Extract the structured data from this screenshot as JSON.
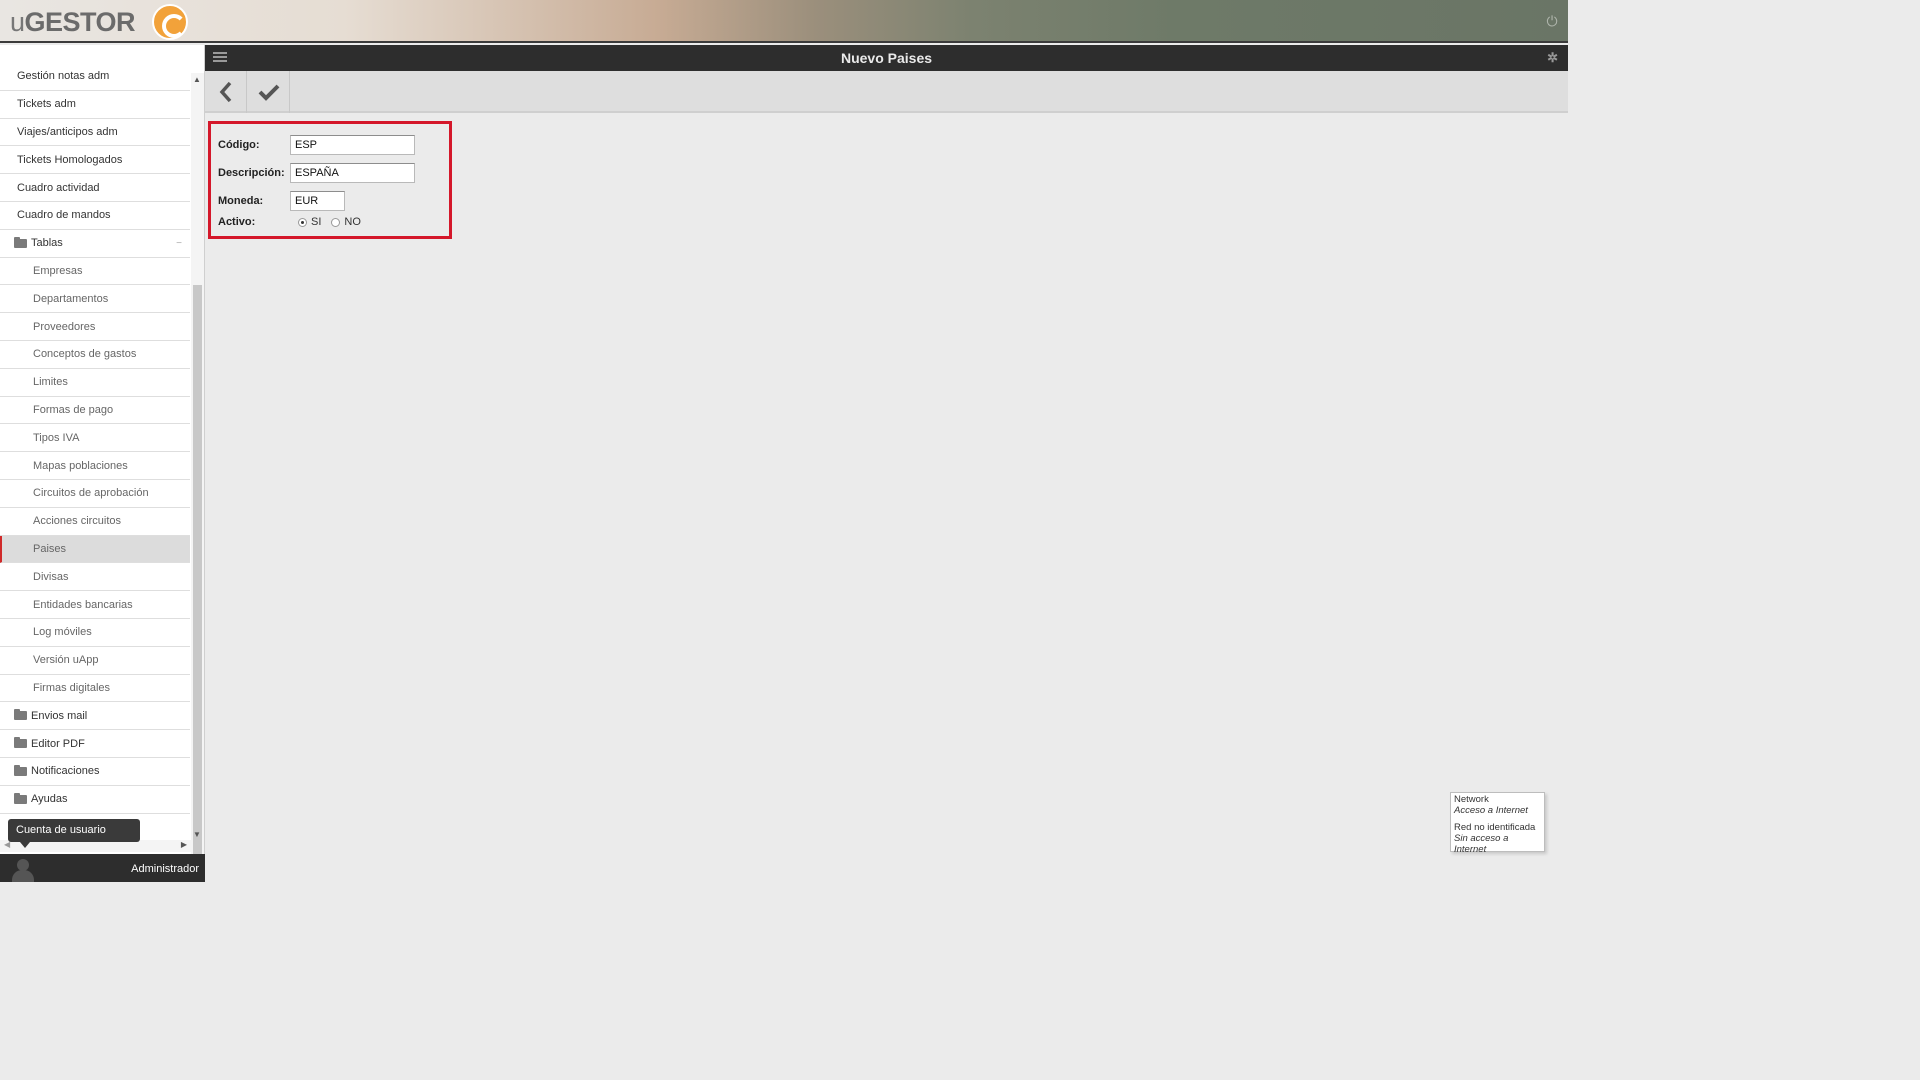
{
  "header": {
    "logo_prefix": "u",
    "logo_text": "GESTOR",
    "power_icon": "power-icon"
  },
  "sidebar": {
    "items": [
      {
        "label": "Gestión notas adm",
        "type": "item"
      },
      {
        "label": "Tickets adm",
        "type": "item"
      },
      {
        "label": "Viajes/anticipos adm",
        "type": "item"
      },
      {
        "label": "Tickets Homologados",
        "type": "item"
      },
      {
        "label": "Cuadro actividad",
        "type": "item"
      },
      {
        "label": "Cuadro de mandos",
        "type": "item"
      },
      {
        "label": "Tablas",
        "type": "folder",
        "expanded": true
      },
      {
        "label": "Empresas",
        "type": "sub"
      },
      {
        "label": "Departamentos",
        "type": "sub"
      },
      {
        "label": "Proveedores",
        "type": "sub"
      },
      {
        "label": "Conceptos de gastos",
        "type": "sub"
      },
      {
        "label": "Limites",
        "type": "sub"
      },
      {
        "label": "Formas de pago",
        "type": "sub"
      },
      {
        "label": "Tipos IVA",
        "type": "sub"
      },
      {
        "label": "Mapas poblaciones",
        "type": "sub"
      },
      {
        "label": "Circuitos de aprobación",
        "type": "sub"
      },
      {
        "label": "Acciones circuitos",
        "type": "sub"
      },
      {
        "label": "Paises",
        "type": "sub",
        "active": true
      },
      {
        "label": "Divisas",
        "type": "sub"
      },
      {
        "label": "Entidades bancarias",
        "type": "sub"
      },
      {
        "label": "Log móviles",
        "type": "sub"
      },
      {
        "label": "Versión uApp",
        "type": "sub"
      },
      {
        "label": "Firmas digitales",
        "type": "sub"
      },
      {
        "label": "Envios mail",
        "type": "folder"
      },
      {
        "label": "Editor PDF",
        "type": "folder"
      },
      {
        "label": "Notificaciones",
        "type": "folder"
      },
      {
        "label": "Ayudas",
        "type": "folder"
      }
    ],
    "tooltip": "Cuenta de usuario",
    "user_name": "Administrador"
  },
  "page": {
    "title": "Nuevo Paises",
    "toolbar": {
      "back_icon": "chevron-left-icon",
      "save_icon": "check-icon"
    }
  },
  "form": {
    "codigo_label": "Código:",
    "codigo_value": "ESP",
    "descripcion_label": "Descripción:",
    "descripcion_value": "ESPAÑA",
    "moneda_label": "Moneda:",
    "moneda_value": "EUR",
    "activo_label": "Activo:",
    "activo_options": [
      "SI",
      "NO"
    ],
    "activo_selected": "SI"
  },
  "network_popup": {
    "line1": "Network",
    "line2": "Acceso a Internet",
    "line3": "Red no identificada",
    "line4": "Sin acceso a Internet"
  },
  "colors": {
    "highlight_border": "#d4172a",
    "active_marker": "#d02a2a",
    "logo_orange": "#f2a23a"
  }
}
